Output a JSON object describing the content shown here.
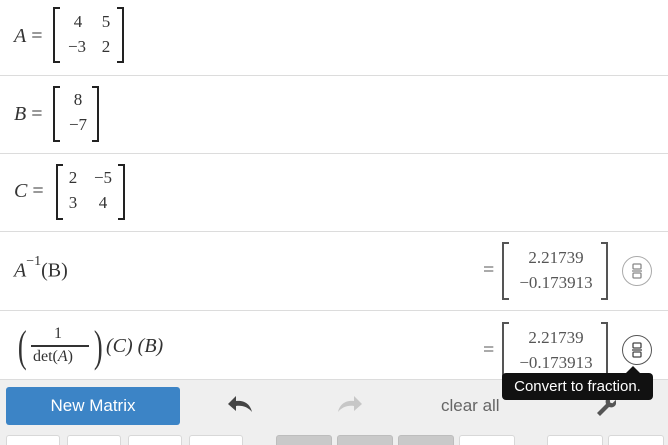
{
  "rows": [
    {
      "id": "A",
      "label": "A",
      "equals": "=",
      "matrix": [
        [
          "4",
          "5"
        ],
        [
          "−3",
          "2"
        ]
      ]
    },
    {
      "id": "B",
      "label": "B",
      "equals": "=",
      "matrix": [
        [
          "8"
        ],
        [
          "−7"
        ]
      ]
    },
    {
      "id": "C",
      "label": "C",
      "equals": "=",
      "matrix": [
        [
          "2",
          "−5"
        ],
        [
          "3",
          "4"
        ]
      ]
    },
    {
      "id": "expr1",
      "expression": {
        "base": "A",
        "superscript": "−1",
        "arg": "(B)"
      },
      "result_equals": "=",
      "result": [
        "2.21739",
        "−0.173913"
      ]
    },
    {
      "id": "expr2",
      "expression": {
        "numerator": "1",
        "denominator_fn": "det",
        "denominator_arg": "A",
        "rest": "(C) (B)"
      },
      "result_equals": "=",
      "result": [
        "2.21739",
        "−0.173913"
      ]
    }
  ],
  "tooltip": {
    "text": "Convert to fraction."
  },
  "toolbar": {
    "new_matrix_label": "New Matrix",
    "clear_all_label": "clear all",
    "undo_icon": "undo-arrow-icon",
    "redo_icon": "redo-arrow-icon",
    "settings_icon": "wrench-icon"
  },
  "colors": {
    "accent": "#3c84c6",
    "tooltip_bg": "#111111",
    "toolbar_bg": "#efefef"
  }
}
